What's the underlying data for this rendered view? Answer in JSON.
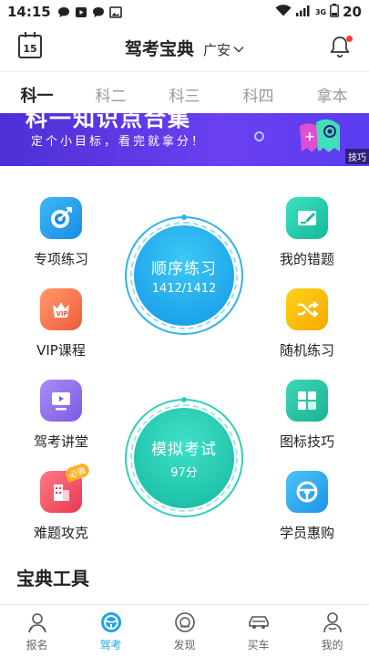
{
  "status_bar": {
    "time": "14:15",
    "network": "3G",
    "battery": "20"
  },
  "header": {
    "calendar_day": "15",
    "title": "驾考宝典",
    "city": "广安"
  },
  "tabs": [
    {
      "label": "科一",
      "active": true
    },
    {
      "label": "科二",
      "active": false
    },
    {
      "label": "科三",
      "active": false
    },
    {
      "label": "科四",
      "active": false
    },
    {
      "label": "拿本",
      "active": false
    }
  ],
  "banner": {
    "title": "科一知识点合集",
    "subtitle": "定个小目标，看完就拿分！",
    "tag": "技巧"
  },
  "features": {
    "special_practice": "专项练习",
    "vip_course": "VIP课程",
    "lecture": "驾考讲堂",
    "hard_questions": "难题攻克",
    "my_mistakes": "我的错题",
    "random_practice": "随机练习",
    "sign_tips": "图标技巧",
    "student_discount": "学员惠购",
    "hard_badge": "必做",
    "vip_badge": "VIP"
  },
  "sequential": {
    "title": "顺序练习",
    "progress": "1412/1412"
  },
  "mock_exam": {
    "title": "模拟考试",
    "score": "97分"
  },
  "section": {
    "title": "宝典工具"
  },
  "bottom_nav": [
    {
      "label": "报名",
      "icon": "signup-icon",
      "active": false
    },
    {
      "label": "驾考",
      "icon": "steering-icon",
      "active": true
    },
    {
      "label": "发现",
      "icon": "discover-icon",
      "active": false
    },
    {
      "label": "买车",
      "icon": "car-icon",
      "active": false
    },
    {
      "label": "我的",
      "icon": "profile-icon",
      "active": false
    }
  ],
  "colors": {
    "accent": "#1ea6e8",
    "banner": "#5b3cf0",
    "notification_dot": "#ff3b30"
  }
}
